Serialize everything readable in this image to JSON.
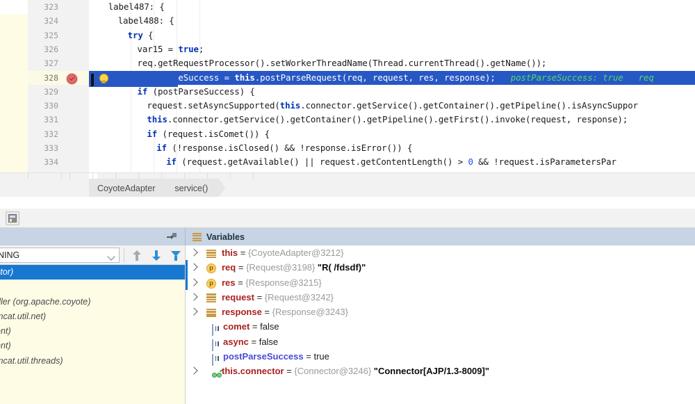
{
  "editor": {
    "lines": [
      {
        "num": "323",
        "indent": 4,
        "html_text": "label487: {",
        "exec": false
      },
      {
        "num": "324",
        "indent": 6,
        "html_text": "label488: {",
        "exec": false
      },
      {
        "num": "325",
        "indent": 8,
        "html_text": "try {",
        "exec": false
      },
      {
        "num": "326",
        "indent": 10,
        "html_text": "var15 = true;",
        "exec": false
      },
      {
        "num": "327",
        "indent": 10,
        "html_text": "req.getRequestProcessor().setWorkerThreadName(Thread.currentThread().getName());",
        "exec": false
      },
      {
        "num": "328",
        "indent": 10,
        "html_text": "postParseSuccess = this.postParseRequest(req, request, res, response);",
        "exec": true,
        "hint": "postParseSuccess: true   req"
      },
      {
        "num": "329",
        "indent": 10,
        "html_text": "if (postParseSuccess) {",
        "exec": false
      },
      {
        "num": "330",
        "indent": 12,
        "html_text": "request.setAsyncSupported(this.connector.getService().getContainer().getPipeline().isAsyncSuppor",
        "exec": false
      },
      {
        "num": "331",
        "indent": 12,
        "html_text": "this.connector.getService().getContainer().getPipeline().getFirst().invoke(request, response);",
        "exec": false
      },
      {
        "num": "332",
        "indent": 12,
        "html_text": "if (request.isComet()) {",
        "exec": false
      },
      {
        "num": "333",
        "indent": 14,
        "html_text": "if (!response.isClosed() && !response.isError()) {",
        "exec": false
      },
      {
        "num": "334",
        "indent": 16,
        "html_text": "if (request.getAvailable() || request.getContentLength() > 0 && !request.isParametersPar",
        "exec": false
      }
    ],
    "breakpoint_line": "328",
    "icons": {
      "breakpoint": "breakpoint-icon",
      "execution_pointer": "execution-pointer-icon",
      "intention": "lightbulb-icon"
    }
  },
  "breadcrumb": {
    "items": [
      {
        "label": "CoyoteAdapter",
        "shaded": true
      },
      {
        "label": "service()",
        "shaded": true
      }
    ]
  },
  "debug_toolbar": {
    "evaluate_expression_label": "calculator-icon"
  },
  "frames_panel": {
    "header_pin_label": "settings-pin-icon",
    "thread_select_value": "NING",
    "buttons": [
      {
        "name": "move-up-button",
        "label": "arrow-up-icon"
      },
      {
        "name": "move-down-button",
        "label": "arrow-down-icon"
      },
      {
        "name": "filter-button",
        "label": "funnel-icon"
      }
    ],
    "frames": [
      {
        "text": "ctor)",
        "selected": true,
        "offset": -6
      },
      {
        "text": "",
        "selected": false,
        "offset": 0
      },
      {
        "text": "dler (org.apache.coyote)",
        "selected": false,
        "offset": -6
      },
      {
        "text": "mcat.util.net)",
        "selected": false,
        "offset": -6
      },
      {
        "text": "ent)",
        "selected": false,
        "offset": -6
      },
      {
        "text": "ent)",
        "selected": false,
        "offset": -6
      },
      {
        "text": "mcat.util.threads)",
        "selected": false,
        "offset": -6
      }
    ]
  },
  "variables_panel": {
    "title": "Variables",
    "rows": [
      {
        "expandable": true,
        "icon": "stack",
        "name": "this",
        "modified": false,
        "eq": " = ",
        "ref": "{CoyoteAdapter@3212}",
        "value": ""
      },
      {
        "expandable": true,
        "icon": "param",
        "name": "req",
        "modified": false,
        "eq": " = ",
        "ref": "{Request@3198}",
        "value": "\"R( /fdsdf)\""
      },
      {
        "expandable": true,
        "icon": "param",
        "name": "res",
        "modified": false,
        "eq": " = ",
        "ref": "{Response@3215}",
        "value": ""
      },
      {
        "expandable": true,
        "icon": "stack",
        "name": "request",
        "modified": false,
        "eq": " = ",
        "ref": "{Request@3242}",
        "value": ""
      },
      {
        "expandable": true,
        "icon": "stack",
        "name": "response",
        "modified": false,
        "eq": " = ",
        "ref": "{Response@3243}",
        "value": ""
      },
      {
        "expandable": false,
        "icon": "prim",
        "name": "comet",
        "modified": false,
        "eq": " = ",
        "ref": "",
        "value": "false",
        "bool": true
      },
      {
        "expandable": false,
        "icon": "prim",
        "name": "async",
        "modified": false,
        "eq": " = ",
        "ref": "",
        "value": "false",
        "bool": true
      },
      {
        "expandable": false,
        "icon": "prim",
        "name": "postParseSuccess",
        "modified": true,
        "eq": " = ",
        "ref": "",
        "value": "true",
        "bool": true
      },
      {
        "expandable": true,
        "icon": "field",
        "name": "this.connector",
        "modified": false,
        "eq": " = ",
        "ref": "{Connector@3246}",
        "value": "\"Connector[AJP/1.3-8009]\""
      }
    ]
  },
  "colors": {
    "exec_line_bg": "#2757c4",
    "hint_green": "#4ddd66",
    "keyword_blue": "#0033b3",
    "panel_header": "#c6d4e4",
    "frames_bg": "#fffce6",
    "selection_blue": "#1878cf",
    "var_name_red": "#aa1f1f",
    "var_name_modified": "#4a4ad6"
  }
}
